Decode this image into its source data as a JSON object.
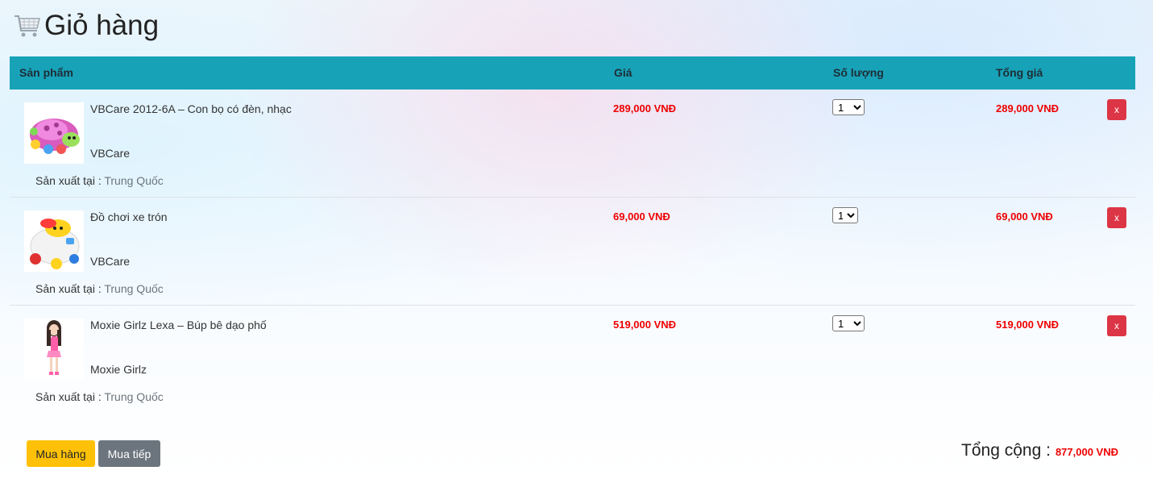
{
  "page": {
    "title": "Giỏ hàng"
  },
  "table": {
    "headers": {
      "product": "Sản phẩm",
      "price": "Giá",
      "quantity": "Số lượng",
      "total": "Tổng giá"
    },
    "origin_label": "Sản xuất tại",
    "origin_sep": " : ",
    "delete_label": "x",
    "rows": [
      {
        "name": "VBCare 2012-6A – Con bọ có đèn, nhạc",
        "brand": "VBCare",
        "origin": "Trung Quốc",
        "price": "289,000 VNĐ",
        "quantity": "1",
        "total": "289,000 VNĐ",
        "image_icon": "toy-ladybug-image"
      },
      {
        "name": "Đồ chơi xe trón",
        "brand": "VBCare",
        "origin": "Trung Quốc",
        "price": "69,000 VNĐ",
        "quantity": "1",
        "total": "69,000 VNĐ",
        "image_icon": "toy-car-image"
      },
      {
        "name": "Moxie Girlz Lexa – Búp bê dạo phố",
        "brand": "Moxie Girlz",
        "origin": "Trung Quốc",
        "price": "519,000 VNĐ",
        "quantity": "1",
        "total": "519,000 VNĐ",
        "image_icon": "doll-image"
      }
    ]
  },
  "actions": {
    "buy_label": "Mua hàng",
    "continue_label": "Mua tiếp"
  },
  "summary": {
    "label": "Tổng cộng :",
    "value": "877,000 VNĐ"
  },
  "colors": {
    "header_bg": "#17a2b8",
    "price": "#e00000",
    "delete": "#dc3545",
    "buy": "#ffc107",
    "continue": "#6c757d"
  }
}
